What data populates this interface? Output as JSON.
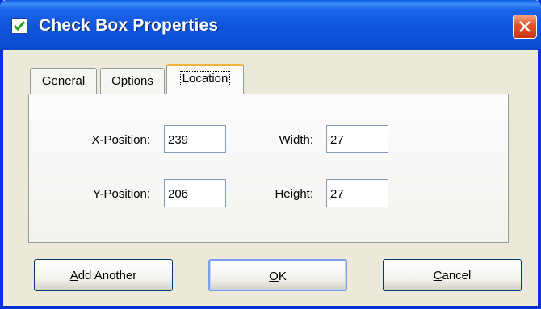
{
  "window": {
    "title": "Check Box Properties"
  },
  "tabs": [
    {
      "label": "General",
      "active": false
    },
    {
      "label": "Options",
      "active": false
    },
    {
      "label": "Location",
      "active": true
    }
  ],
  "location": {
    "x_label": "X-Position:",
    "x_value": "239",
    "y_label": "Y-Position:",
    "y_value": "206",
    "width_label": "Width:",
    "width_value": "27",
    "height_label": "Height:",
    "height_value": "27"
  },
  "buttons": {
    "add_another": {
      "mnemonic": "A",
      "rest": "dd Another"
    },
    "ok": {
      "mnemonic": "O",
      "rest": "K"
    },
    "cancel": {
      "mnemonic": "C",
      "rest": "ancel"
    }
  },
  "colors": {
    "titlebar": "#0c4fd4",
    "close": "#e2512b",
    "active_tab_accent": "#f5b33b"
  }
}
